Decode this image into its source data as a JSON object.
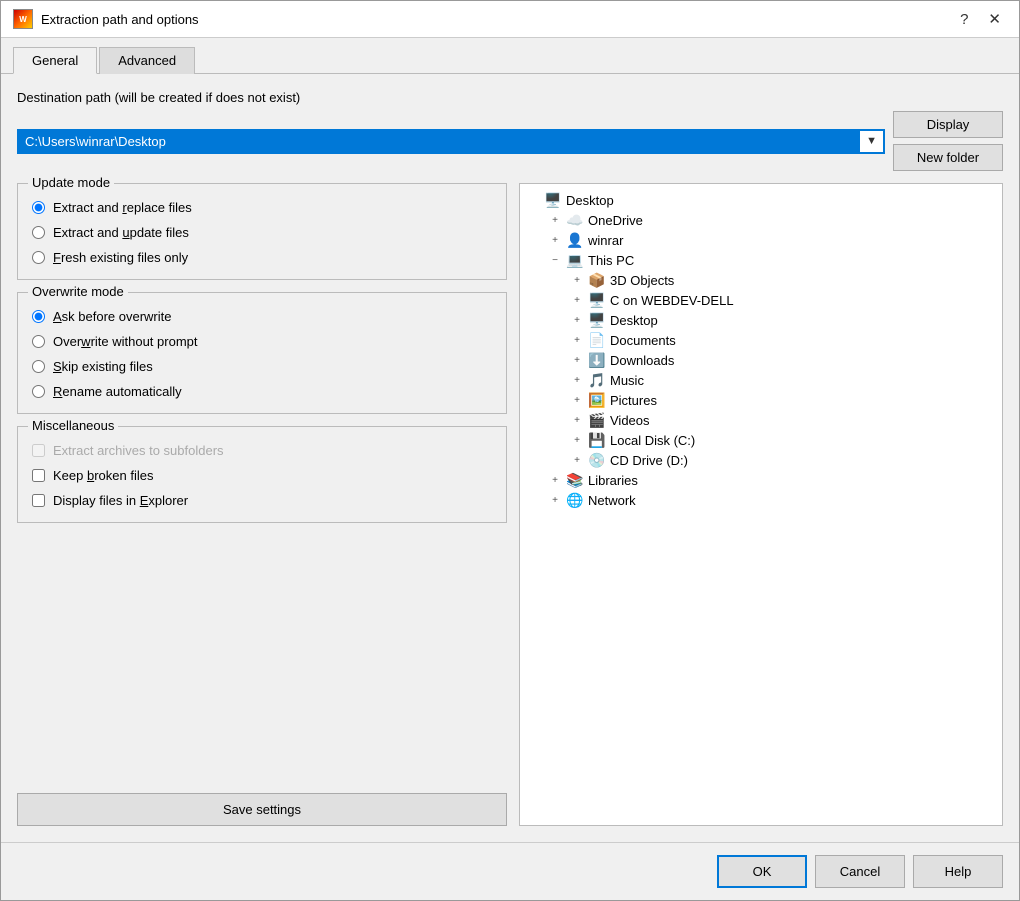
{
  "dialog": {
    "title": "Extraction path and options",
    "help_btn": "?",
    "close_btn": "✕"
  },
  "tabs": [
    {
      "id": "general",
      "label": "General",
      "active": true
    },
    {
      "id": "advanced",
      "label": "Advanced",
      "active": false
    }
  ],
  "destination": {
    "label": "Destination path (will be created if does not exist)",
    "path": "C:\\Users\\winrar\\Desktop",
    "display_btn": "Display",
    "new_folder_btn": "New folder"
  },
  "update_mode": {
    "group_label": "Update mode",
    "options": [
      {
        "id": "extract_replace",
        "label": "Extract and replace files",
        "checked": true,
        "underline_char": "r"
      },
      {
        "id": "extract_update",
        "label": "Extract and update files",
        "checked": false,
        "underline_char": "u"
      },
      {
        "id": "fresh_existing",
        "label": "Fresh existing files only",
        "checked": false,
        "underline_char": "F"
      }
    ]
  },
  "overwrite_mode": {
    "group_label": "Overwrite mode",
    "options": [
      {
        "id": "ask_before",
        "label": "Ask before overwrite",
        "checked": true,
        "underline_char": "A"
      },
      {
        "id": "overwrite_no_prompt",
        "label": "Overwrite without prompt",
        "checked": false,
        "underline_char": "w"
      },
      {
        "id": "skip_existing",
        "label": "Skip existing files",
        "checked": false,
        "underline_char": "S"
      },
      {
        "id": "rename_auto",
        "label": "Rename automatically",
        "checked": false,
        "underline_char": "R"
      }
    ]
  },
  "miscellaneous": {
    "group_label": "Miscellaneous",
    "options": [
      {
        "id": "extract_subfolders",
        "label": "Extract archives to subfolders",
        "checked": false,
        "disabled": true
      },
      {
        "id": "keep_broken",
        "label": "Keep broken files",
        "checked": false,
        "disabled": false,
        "underline_char": "b"
      },
      {
        "id": "display_explorer",
        "label": "Display files in Explorer",
        "checked": false,
        "disabled": false,
        "underline_char": "E"
      }
    ]
  },
  "save_settings_btn": "Save settings",
  "tree": {
    "items": [
      {
        "id": "desktop",
        "level": 0,
        "label": "Desktop",
        "icon": "🖥️",
        "expanded": true,
        "selected": false
      },
      {
        "id": "onedrive",
        "level": 1,
        "label": "OneDrive",
        "icon": "☁️",
        "expanded": false
      },
      {
        "id": "winrar",
        "level": 1,
        "label": "winrar",
        "icon": "👤",
        "expanded": false
      },
      {
        "id": "this_pc",
        "level": 1,
        "label": "This PC",
        "icon": "💻",
        "expanded": true
      },
      {
        "id": "3d_objects",
        "level": 2,
        "label": "3D Objects",
        "icon": "📦",
        "expanded": false
      },
      {
        "id": "c_drive",
        "level": 2,
        "label": "C on WEBDEV-DELL",
        "icon": "🖥️",
        "expanded": false
      },
      {
        "id": "desktop2",
        "level": 2,
        "label": "Desktop",
        "icon": "🖥️",
        "expanded": false
      },
      {
        "id": "documents",
        "level": 2,
        "label": "Documents",
        "icon": "📄",
        "expanded": false
      },
      {
        "id": "downloads",
        "level": 2,
        "label": "Downloads",
        "icon": "⬇️",
        "expanded": false
      },
      {
        "id": "music",
        "level": 2,
        "label": "Music",
        "icon": "🎵",
        "expanded": false
      },
      {
        "id": "pictures",
        "level": 2,
        "label": "Pictures",
        "icon": "🖼️",
        "expanded": false
      },
      {
        "id": "videos",
        "level": 2,
        "label": "Videos",
        "icon": "🎬",
        "expanded": false
      },
      {
        "id": "local_disk",
        "level": 2,
        "label": "Local Disk (C:)",
        "icon": "💾",
        "expanded": false
      },
      {
        "id": "cd_drive",
        "level": 2,
        "label": "CD Drive (D:)",
        "icon": "💿",
        "expanded": false
      },
      {
        "id": "libraries",
        "level": 1,
        "label": "Libraries",
        "icon": "📚",
        "expanded": false
      },
      {
        "id": "network",
        "level": 1,
        "label": "Network",
        "icon": "🌐",
        "expanded": false
      }
    ]
  },
  "footer": {
    "ok_btn": "OK",
    "cancel_btn": "Cancel",
    "help_btn": "Help"
  }
}
